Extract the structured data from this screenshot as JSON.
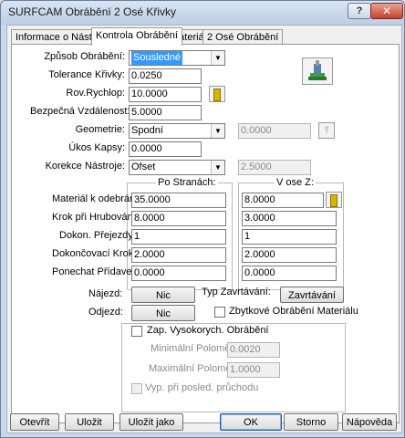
{
  "window": {
    "title": "SURFCAM Obrábění 2 Osé Křivky",
    "help_label": "?",
    "close_label": "✕"
  },
  "tabs": [
    {
      "label": "Informace o Nástroji"
    },
    {
      "label": "Kontrola Obrábění"
    },
    {
      "label": "Materiál"
    },
    {
      "label": "2 Osé Obrábění"
    }
  ],
  "form": {
    "method_label": "Způsob Obrábění:",
    "method_value": "Sousledné",
    "tolerance_label": "Tolerance Křivky:",
    "tolerance_value": "0.0250",
    "rapid_label": "Rov.Rychlop:",
    "rapid_value": "10.0000",
    "safe_label": "Bezpečná Vzdálenost:",
    "safe_value": "5.0000",
    "geometry_label": "Geometrie:",
    "geometry_value": "Spodní",
    "geometry_extra_value": "0.0000",
    "taper_label": "Úkos Kapsy:",
    "taper_value": "0.0000",
    "comp_label": "Korekce Nástroje:",
    "comp_value": "Ofset",
    "comp_extra_value": "2.5000"
  },
  "table": {
    "col_side": "Po Stranách:",
    "col_z": "V ose Z:",
    "rows": [
      {
        "label": "Materiál k odebrání:",
        "side": "35.0000",
        "z": "8.0000"
      },
      {
        "label": "Krok při Hrubování:",
        "side": "8.0000",
        "z": "3.0000"
      },
      {
        "label": "Dokon. Přejezdy:",
        "side": "1",
        "z": "1"
      },
      {
        "label": "Dokončovací Krok:",
        "side": "2.0000",
        "z": "2.0000"
      },
      {
        "label": "Ponechat Přídavek:",
        "side": "0.0000",
        "z": "0.0000"
      }
    ]
  },
  "entry": {
    "approach_label": "Nájezd:",
    "approach_button": "Nic",
    "exit_label": "Odjezd:",
    "exit_button": "Nic",
    "plunge_label": "Typ Zavrtávání:",
    "plunge_button": "Zavrtávání",
    "rest_label": "Zbytkové Obrábění Materiálu"
  },
  "hsm": {
    "enable_label": "Zap. Vysokorych. Obrábění",
    "min_radius_label": "Minimální Poloměr:",
    "min_radius_value": "0.0020",
    "max_radius_label": "Maximální Poloměr:",
    "max_radius_value": "1.0000",
    "last_pass_label": "Vyp. při posled. průchodu"
  },
  "buttons": {
    "open": "Otevřít",
    "save": "Uložit",
    "save_as": "Uložit jako",
    "ok": "OK",
    "cancel": "Storno",
    "help": "Nápověda"
  },
  "colors": {
    "accent": "#3399ff",
    "title_bar": "#c9d8ea",
    "close": "#c5422c"
  }
}
